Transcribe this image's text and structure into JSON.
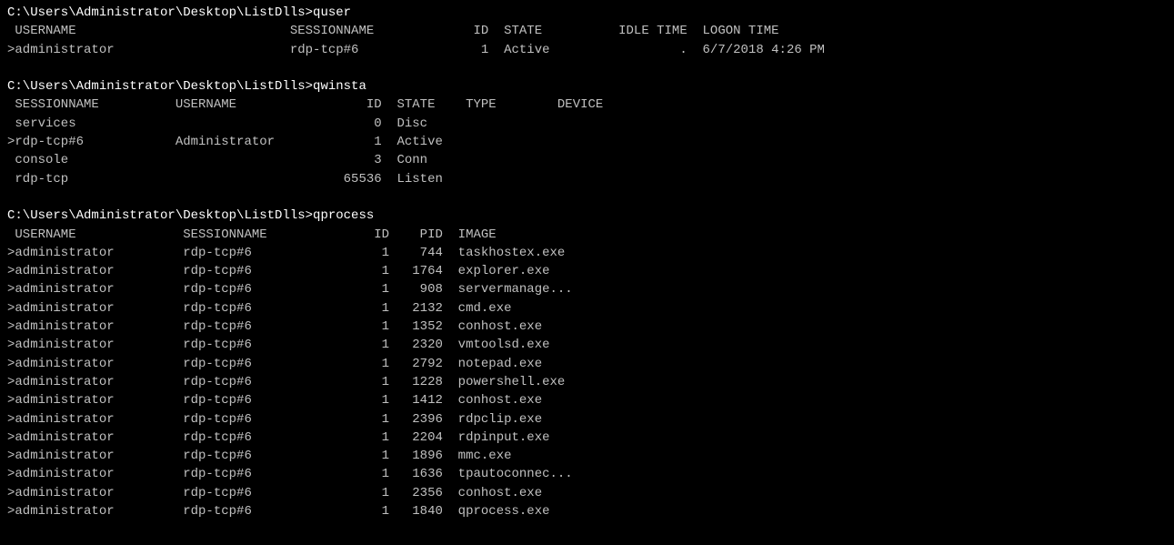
{
  "terminal": {
    "content": [
      "C:\\Users\\Administrator\\Desktop\\ListDlls>quser",
      " USERNAME                            SESSIONNAME             ID  STATE          IDLE TIME  LOGON TIME",
      ">administrator                       rdp-tcp#6                1  Active                 .  6/7/2018 4:26 PM",
      "",
      "C:\\Users\\Administrator\\Desktop\\ListDlls>qwinsta",
      " SESSIONNAME          USERNAME                 ID  STATE    TYPE        DEVICE",
      " services                                       0  Disc",
      ">rdp-tcp#6            Administrator             1  Active",
      " console                                        3  Conn",
      " rdp-tcp                                    65536  Listen",
      "",
      "C:\\Users\\Administrator\\Desktop\\ListDlls>qprocess",
      " USERNAME              SESSIONNAME              ID    PID  IMAGE",
      ">administrator         rdp-tcp#6                 1    744  taskhostex.exe",
      ">administrator         rdp-tcp#6                 1   1764  explorer.exe",
      ">administrator         rdp-tcp#6                 1    908  servermanage...",
      ">administrator         rdp-tcp#6                 1   2132  cmd.exe",
      ">administrator         rdp-tcp#6                 1   1352  conhost.exe",
      ">administrator         rdp-tcp#6                 1   2320  vmtoolsd.exe",
      ">administrator         rdp-tcp#6                 1   2792  notepad.exe",
      ">administrator         rdp-tcp#6                 1   1228  powershell.exe",
      ">administrator         rdp-tcp#6                 1   1412  conhost.exe",
      ">administrator         rdp-tcp#6                 1   2396  rdpclip.exe",
      ">administrator         rdp-tcp#6                 1   2204  rdpinput.exe",
      ">administrator         rdp-tcp#6                 1   1896  mmc.exe",
      ">administrator         rdp-tcp#6                 1   1636  tpautoconnec...",
      ">administrator         rdp-tcp#6                 1   2356  conhost.exe",
      ">administrator         rdp-tcp#6                 1   1840  qprocess.exe"
    ]
  }
}
